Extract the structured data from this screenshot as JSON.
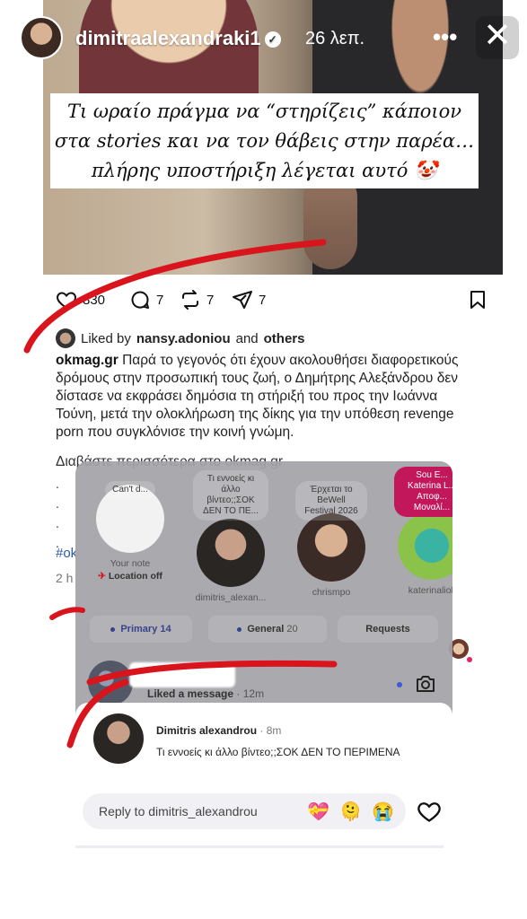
{
  "story": {
    "username": "dimitraalexandraki1",
    "time": "26 λεπ.",
    "more": "•••",
    "close": "✕"
  },
  "quote": {
    "line1": "Τι ωραίο πράγμα να “στηρίζεις” κάποιον",
    "line2": "στα stories και να τον θάβεις στην παρέα…",
    "line3": "πλήρης υποστήριξη λέγεται αυτό 🤡"
  },
  "post": {
    "likes": "830",
    "comments": "7",
    "reposts": "7",
    "shares": "7",
    "liked_by_prefix": "Liked by",
    "liked_by_user": "nansy.adoniou",
    "liked_by_and": "and",
    "liked_by_others": "others",
    "caption_user": "okmag.gr",
    "caption_text": "Παρά το γεγονός ότι έχουν ακολουθήσει διαφορετικούς δρόμους στην προσωπική τους ζωή, ο Δημήτρης Αλεξάνδρου δεν δίστασε να εκφράσει δημόσια τη στήριξή του προς την Ιωάννα Τούνη, μετά την ολοκλήρωση της δίκης για την υπόθεση revenge porn που συγκλόνισε την κοινή γνώμη.",
    "read_more": "Διαβάστε περισσότερα στο okmag.gr",
    "dots": ".\n.\n.\n.",
    "hashtag": "#ok",
    "ago": "2 h"
  },
  "dm": {
    "notes": [
      {
        "bubble": "Can't d...",
        "name": "Your note",
        "sub": "Location off"
      },
      {
        "bubble": "Τι εννοείς κι άλλο βίντεο;;ΣΟΚ ΔΕΝ ΤΟ ΠΕ...",
        "name": "dimitris_alexan..."
      },
      {
        "bubble": "Έρχεται το BeWell Festival 2026",
        "name": "chrismpo"
      },
      {
        "bubble": "Sou E... Katerina L... Αποφ... Μοναλί...",
        "name": "katerinalioli"
      }
    ],
    "tabs": [
      {
        "label": "Primary",
        "count": "14"
      },
      {
        "label": "General",
        "count": "20"
      },
      {
        "label": "Requests",
        "count": ""
      }
    ],
    "thread_sub": "Liked a message",
    "thread_time": "· 12m"
  },
  "notification": {
    "name": "Dimitris alexandrou",
    "time": "· 8m",
    "message": "Τι εννοείς κι άλλο βίντεο;;ΣΟΚ ΔΕΝ ΤΟ ΠΕΡΙΜΕΝΑ"
  },
  "reply": {
    "placeholder": "Reply to dimitris_alexandrou",
    "emojis": [
      "💝",
      "🫠",
      "😭"
    ]
  },
  "colors": {
    "accent_red": "#d9141d",
    "link_blue": "#2b5aa8",
    "tab_text": "#39418a"
  }
}
